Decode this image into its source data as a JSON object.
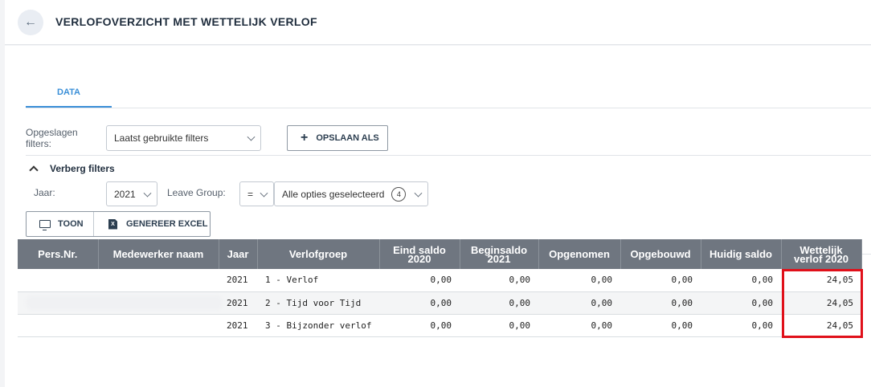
{
  "header": {
    "title": "VERLOFOVERZICHT MET WETTELIJK VERLOF",
    "back_icon": "arrow-left-icon"
  },
  "tabs": [
    {
      "label": "DATA",
      "active": true
    }
  ],
  "filters": {
    "saved_label": "Opgeslagen filters:",
    "saved_value": "Laatst gebruikte filters",
    "save_as_label": "OPSLAAN ALS",
    "toggle_label": "Verberg filters",
    "year_label": "Jaar:",
    "year_value": "2021",
    "leave_group_label": "Leave Group:",
    "operator_value": "=",
    "options_value": "Alle opties geselecteerd",
    "options_count": "4"
  },
  "actions": {
    "show_label": "TOON",
    "excel_label": "GENEREER EXCEL"
  },
  "table": {
    "headers": [
      "Pers.Nr.",
      "Medewerker naam",
      "Jaar",
      "Verlofgroep",
      "Eind saldo 2020",
      "Beginsaldo 2021",
      "Opgenomen",
      "Opgebouwd",
      "Huidig saldo",
      "Wettelijk verlof 2020"
    ],
    "rows": [
      [
        "",
        "",
        "2021",
        "1 - Verlof",
        "0,00",
        "0,00",
        "0,00",
        "0,00",
        "0,00",
        "24,05"
      ],
      [
        "",
        "",
        "2021",
        "2 - Tijd voor Tijd",
        "0,00",
        "0,00",
        "0,00",
        "0,00",
        "0,00",
        "24,05"
      ],
      [
        "",
        "",
        "2021",
        "3 - Bijzonder verlof",
        "0,00",
        "0,00",
        "0,00",
        "0,00",
        "0,00",
        "24,05"
      ]
    ]
  },
  "colors": {
    "accent": "#3a8fd8",
    "table_header": "#6f7680",
    "highlight": "#e0101a"
  }
}
